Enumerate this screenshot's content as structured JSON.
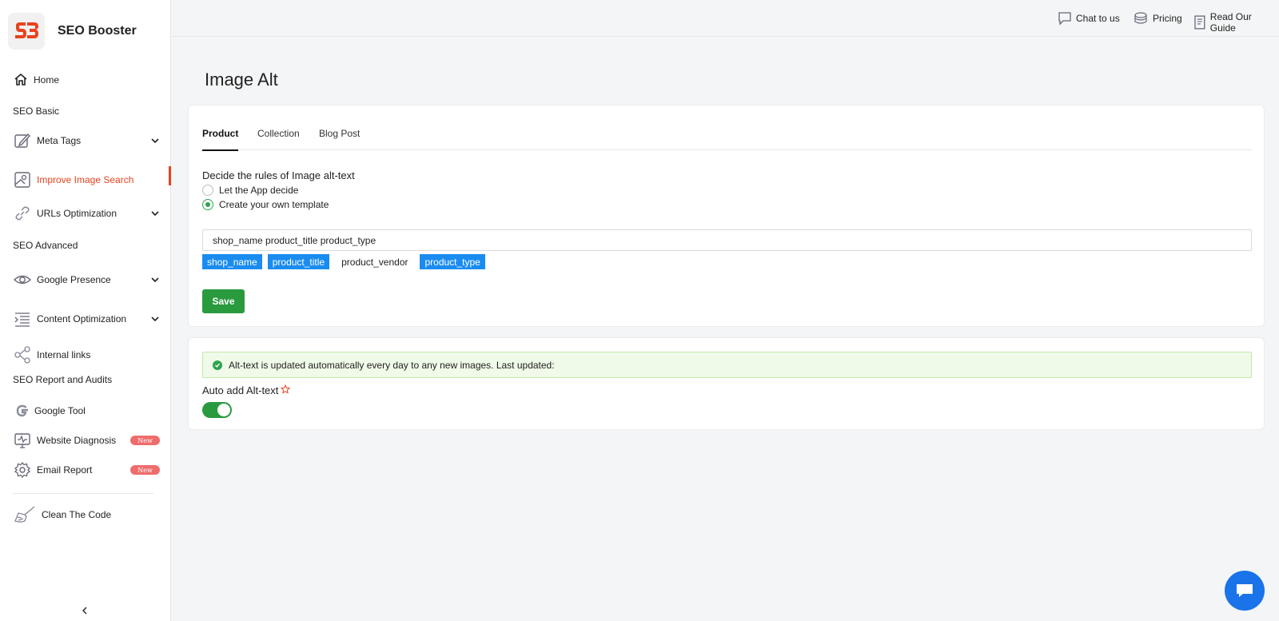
{
  "app": {
    "brand_name": "SEO Booster"
  },
  "topbar": {
    "chat_label": "Chat to us",
    "pricing_label": "Pricing",
    "guide_label": "Read Our Guide"
  },
  "sidebar": {
    "home": "Home",
    "section_basic": "SEO Basic",
    "meta_tags": "Meta Tags",
    "improve_image_search": "Improve Image Search",
    "urls_optimization": "URLs Optimization",
    "section_advanced": "SEO Advanced",
    "google_presence": "Google Presence",
    "content_optimization": "Content Optimization",
    "internal_links": "Internal links",
    "section_report": "SEO Report and Audits",
    "google_tool": "Google Tool",
    "website_diagnosis": "Website Diagnosis",
    "email_report": "Email Report",
    "new_badge": "New",
    "clean_code": "Clean The Code",
    "accent_color": "#e8431f"
  },
  "page": {
    "title": "Image Alt"
  },
  "tabs": [
    {
      "label": "Product",
      "active": true
    },
    {
      "label": "Collection",
      "active": false
    },
    {
      "label": "Blog Post",
      "active": false
    }
  ],
  "rules": {
    "title": "Decide the rules of Image alt-text",
    "option_app": "Let the App decide",
    "option_template": "Create your own template",
    "selected": "Create your own template",
    "template_value": "shop_name product_title product_type",
    "chips": [
      {
        "label": "shop_name",
        "selected": true
      },
      {
        "label": "product_title",
        "selected": true
      },
      {
        "label": "product_vendor",
        "selected": false
      },
      {
        "label": "product_type",
        "selected": true
      }
    ],
    "save_label": "Save"
  },
  "auto": {
    "alert_text": "Alt-text is updated automatically every day to any new images. Last updated:",
    "label": "Auto add Alt-text",
    "enabled": true
  }
}
